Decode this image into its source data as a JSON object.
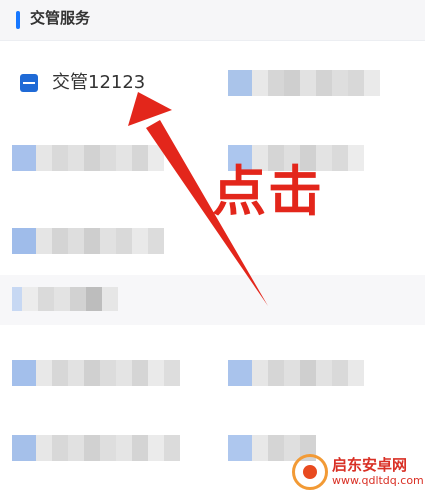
{
  "section": {
    "title": "交管服务"
  },
  "items": [
    {
      "label": "交管12123",
      "icon": "traffic-app-icon"
    }
  ],
  "annotation": {
    "text": "点击",
    "color": "#e3261b"
  },
  "watermark": {
    "name": "启东安卓网",
    "url": "www.qdltdq.com"
  },
  "colors": {
    "accent": "#1677ff",
    "app_icon": "#1f6ad6"
  }
}
